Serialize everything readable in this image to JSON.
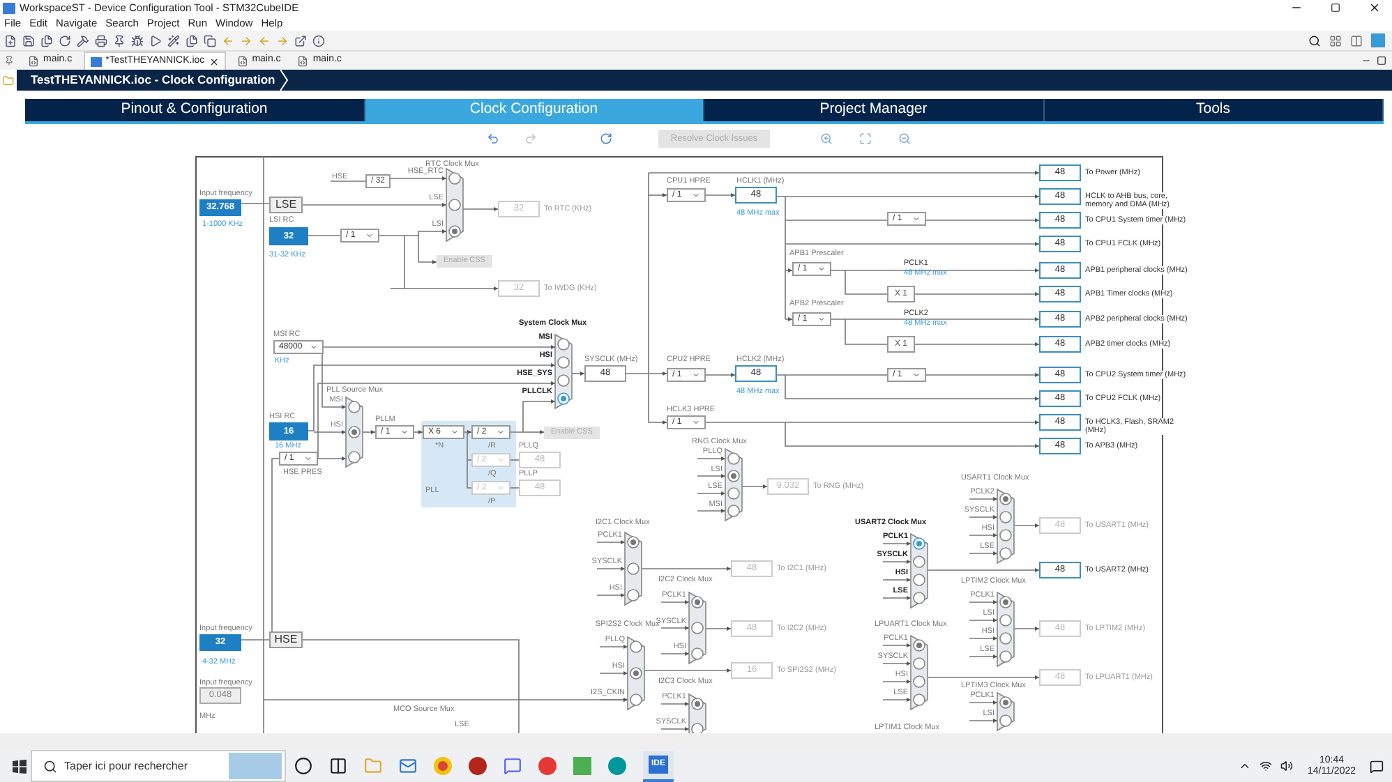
{
  "window": {
    "title": "WorkspaceST - Device Configuration Tool - STM32CubeIDE"
  },
  "menu": [
    "File",
    "Edit",
    "Navigate",
    "Search",
    "Project",
    "Run",
    "Window",
    "Help"
  ],
  "editor_tabs": [
    {
      "label": "main.c",
      "selected": false,
      "kind": "c"
    },
    {
      "label": "*TestTHEYANNICK.ioc",
      "selected": true,
      "kind": "ioc"
    },
    {
      "label": "main.c",
      "selected": false,
      "kind": "c"
    },
    {
      "label": "main.c",
      "selected": false,
      "kind": "c"
    }
  ],
  "breadcrumb": "TestTHEYANNICK.ioc - Clock Configuration",
  "tabs": [
    {
      "label": "Pinout & Configuration",
      "selected": false
    },
    {
      "label": "Clock Configuration",
      "selected": true
    },
    {
      "label": "Project Manager",
      "selected": false
    },
    {
      "label": "Tools",
      "selected": false
    }
  ],
  "resolve_button": {
    "label": "Resolve Clock Issues",
    "disabled": true
  },
  "diagram": {
    "labels": [
      {
        "text": "Input frequency",
        "kind": "caption"
      },
      {
        "text": "1-1000 KHz",
        "kind": "note"
      },
      {
        "text": "LSI RC",
        "kind": "caption"
      },
      {
        "text": "31-32 KHz",
        "kind": "note"
      },
      {
        "text": "HSE",
        "kind": "caption"
      },
      {
        "text": "MSI RC",
        "kind": "caption"
      },
      {
        "text": "KHz",
        "kind": "note"
      },
      {
        "text": "SYSCLK (MHz)",
        "kind": "caption"
      },
      {
        "text": "HSI RC",
        "kind": "caption"
      },
      {
        "text": "16 MHz",
        "kind": "note"
      },
      {
        "text": "HSE PRES",
        "kind": "caption"
      },
      {
        "text": "PLLM",
        "kind": "caption"
      },
      {
        "text": "*N",
        "kind": "caption"
      },
      {
        "text": "/R",
        "kind": "caption"
      },
      {
        "text": "/Q",
        "kind": "caption"
      },
      {
        "text": "PLL",
        "kind": "caption"
      },
      {
        "text": "/P",
        "kind": "caption"
      },
      {
        "text": "PLLQ",
        "kind": "caption"
      },
      {
        "text": "PLLP",
        "kind": "caption"
      },
      {
        "text": "CPU1 HPRE",
        "kind": "caption"
      },
      {
        "text": "HCLK1 (MHz)",
        "kind": "caption"
      },
      {
        "text": "48 MHz max",
        "kind": "note"
      },
      {
        "text": "CPU2 HPRE",
        "kind": "caption"
      },
      {
        "text": "HCLK2 (MHz)",
        "kind": "caption"
      },
      {
        "text": "48 MHz max",
        "kind": "note"
      },
      {
        "text": "HCLK3 HPRE",
        "kind": "caption"
      },
      {
        "text": "APB1 Prescaler",
        "kind": "caption"
      },
      {
        "text": "PCLK1",
        "kind": "dark"
      },
      {
        "text": "48 MHz max",
        "kind": "note"
      },
      {
        "text": "APB2 Prescaler",
        "kind": "caption"
      },
      {
        "text": "PCLK2",
        "kind": "dark"
      },
      {
        "text": "48 MHz max",
        "kind": "note"
      },
      {
        "text": "Input frequency",
        "kind": "caption"
      },
      {
        "text": "4-32 MHz",
        "kind": "note"
      },
      {
        "text": "Input frequency",
        "kind": "caption"
      },
      {
        "text": "MHz",
        "kind": "caption"
      },
      {
        "text": "MCO Source Mux",
        "kind": "caption"
      },
      {
        "text": "LSE",
        "kind": "caption"
      },
      {
        "text": "LPTIM1 Clock Mux",
        "kind": "caption"
      }
    ],
    "blocks": [
      {
        "text": "LSE",
        "kind": "source"
      },
      {
        "text": "HSE",
        "kind": "source"
      },
      {
        "text": "/ 32",
        "kind": "divider"
      },
      {
        "text": "X 1",
        "kind": "divider"
      },
      {
        "text": "X 1",
        "kind": "divider"
      }
    ],
    "buttons": [
      {
        "label": "Enable CSS",
        "disabled": true
      },
      {
        "label": "Enable CSS",
        "disabled": true
      }
    ],
    "dropdowns": [
      {
        "value": "/ 1",
        "disabled": false
      },
      {
        "value": "48000",
        "disabled": false
      },
      {
        "value": "/ 1",
        "disabled": false
      },
      {
        "value": "/ 1",
        "disabled": false
      },
      {
        "value": "X 6",
        "disabled": false
      },
      {
        "value": "/ 2",
        "disabled": false
      },
      {
        "value": "/ 2",
        "disabled": true
      },
      {
        "value": "/ 2",
        "disabled": true
      },
      {
        "value": "/ 1",
        "disabled": false
      },
      {
        "value": "/ 1",
        "disabled": false
      },
      {
        "value": "/ 1",
        "disabled": false
      },
      {
        "value": "/ 1",
        "disabled": false
      },
      {
        "value": "/ 1",
        "disabled": false
      },
      {
        "value": "/ 1",
        "disabled": false
      },
      {
        "value": "/ 1",
        "disabled": false
      }
    ],
    "boxes": [
      {
        "value": "32.768",
        "kind": "input"
      },
      {
        "value": "32",
        "kind": "input"
      },
      {
        "value": "16",
        "kind": "input"
      },
      {
        "value": "32",
        "kind": "input"
      },
      {
        "value": "0.048",
        "kind": "fixed"
      },
      {
        "value": "32",
        "kind": "disabled",
        "target": "To RTC (KHz)"
      },
      {
        "value": "32",
        "kind": "disabled",
        "target": "To IWDG (KHz)"
      },
      {
        "value": "48",
        "kind": "plain"
      },
      {
        "value": "48",
        "kind": "disabled"
      },
      {
        "value": "48",
        "kind": "disabled"
      },
      {
        "value": "48",
        "kind": "active"
      },
      {
        "value": "48",
        "kind": "active"
      },
      {
        "value": "9.032",
        "kind": "disabled",
        "target": "To RNG (MHz)"
      },
      {
        "value": "48",
        "kind": "disabled",
        "target": "To I2C1 (MHz)"
      },
      {
        "value": "48",
        "kind": "disabled",
        "target": "To I2C2 (MHz)"
      },
      {
        "value": "16",
        "kind": "disabled",
        "target": "To SPI2S2 (MHz)"
      },
      {
        "value": "48",
        "kind": "active",
        "target": "To Power (MHz)"
      },
      {
        "value": "48",
        "kind": "active",
        "target": "HCLK to AHB bus, core, memory and DMA (MHz)"
      },
      {
        "value": "48",
        "kind": "active",
        "target": "To CPU1 System timer (MHz)"
      },
      {
        "value": "48",
        "kind": "active",
        "target": "To CPU1 FCLK (MHz)"
      },
      {
        "value": "48",
        "kind": "active",
        "target": "APB1 peripheral clocks (MHz)"
      },
      {
        "value": "48",
        "kind": "active",
        "target": "APB1 Timer clocks (MHz)"
      },
      {
        "value": "48",
        "kind": "active",
        "target": "APB2 peripheral clocks (MHz)"
      },
      {
        "value": "48",
        "kind": "active",
        "target": "APB2 timer clocks (MHz)"
      },
      {
        "value": "48",
        "kind": "active",
        "target": "To CPU2 System timer (MHz)"
      },
      {
        "value": "48",
        "kind": "active",
        "target": "To CPU2 FCLK (MHz)"
      },
      {
        "value": "48",
        "kind": "active",
        "target": "To HCLK3, Flash, SRAM2 (MHz)"
      },
      {
        "value": "48",
        "kind": "active",
        "target": "To APB3 (MHz)"
      },
      {
        "value": "48",
        "kind": "disabled",
        "target": "To USART1 (MHz)"
      },
      {
        "value": "48",
        "kind": "active",
        "target": "To USART2 (MHz)"
      },
      {
        "value": "48",
        "kind": "disabled",
        "target": "To LPTIM2 (MHz)"
      },
      {
        "value": "48",
        "kind": "disabled",
        "target": "To LPUART1 (MHz)"
      }
    ],
    "muxes": [
      {
        "title": "RTC Clock Mux",
        "highlighted": false,
        "inputs": [
          {
            "label": "HSE_RTC",
            "selected": false
          },
          {
            "label": "LSE",
            "selected": false
          },
          {
            "label": "LSI",
            "selected": true
          }
        ]
      },
      {
        "title": "System Clock Mux",
        "highlighted": true,
        "inputs": [
          {
            "label": "MSI",
            "selected": false
          },
          {
            "label": "HSI",
            "selected": false
          },
          {
            "label": "HSE_SYS",
            "selected": false
          },
          {
            "label": "PLLCLK",
            "selected": true
          }
        ]
      },
      {
        "title": "PLL Source Mux",
        "highlighted": false,
        "inputs": [
          {
            "label": "MSI",
            "selected": false
          },
          {
            "label": "HSI",
            "selected": true
          },
          {
            "selected": false
          }
        ]
      },
      {
        "title": "RNG Clock Mux",
        "highlighted": false,
        "inputs": [
          {
            "label": "PLLQ",
            "selected": false
          },
          {
            "label": "LSI",
            "selected": true
          },
          {
            "label": "LSE",
            "selected": false
          },
          {
            "label": "MSI",
            "selected": false
          }
        ]
      },
      {
        "title": "I2C1 Clock Mux",
        "highlighted": false,
        "inputs": [
          {
            "label": "PCLK1",
            "selected": true
          },
          {
            "label": "SYSCLK",
            "selected": false
          },
          {
            "label": "HSI",
            "selected": false
          }
        ]
      },
      {
        "title": "I2C2 Clock Mux",
        "highlighted": false,
        "inputs": [
          {
            "label": "PCLK1",
            "selected": true
          },
          {
            "label": "SYSCLK",
            "selected": false
          },
          {
            "label": "HSI",
            "selected": false
          }
        ]
      },
      {
        "title": "SPI2S2 Clock Mux",
        "highlighted": false,
        "inputs": [
          {
            "label": "PLLQ",
            "selected": false
          },
          {
            "label": "HSI",
            "selected": true
          },
          {
            "label": "I2S_CKIN",
            "selected": false
          }
        ]
      },
      {
        "title": "I2C3 Clock Mux",
        "highlighted": false,
        "inputs": [
          {
            "label": "PCLK1",
            "selected": true
          },
          {
            "label": "SYSCLK",
            "selected": false
          }
        ]
      },
      {
        "title": "USART2 Clock Mux",
        "highlighted": true,
        "inputs": [
          {
            "label": "PCLK1",
            "selected": true
          },
          {
            "label": "SYSCLK",
            "selected": false
          },
          {
            "label": "HSI",
            "selected": false
          },
          {
            "label": "LSE",
            "selected": false
          }
        ]
      },
      {
        "title": "USART1 Clock Mux",
        "highlighted": false,
        "inputs": [
          {
            "label": "PCLK2",
            "selected": true
          },
          {
            "label": "SYSCLK",
            "selected": false
          },
          {
            "label": "HSI",
            "selected": false
          },
          {
            "label": "LSE",
            "selected": false
          }
        ]
      },
      {
        "title": "LPTIM2 Clock Mux",
        "highlighted": false,
        "inputs": [
          {
            "label": "PCLK1",
            "selected": true
          },
          {
            "label": "LSI",
            "selected": false
          },
          {
            "label": "HSI",
            "selected": false
          },
          {
            "label": "LSE",
            "selected": false
          }
        ]
      },
      {
        "title": "LPUART1 Clock Mux",
        "highlighted": false,
        "inputs": [
          {
            "label": "PCLK1",
            "selected": true
          },
          {
            "label": "SYSCLK",
            "selected": false
          },
          {
            "label": "HSI",
            "selected": false
          },
          {
            "label": "LSE",
            "selected": false
          }
        ]
      },
      {
        "title": "LPTIM3 Clock Mux",
        "highlighted": false,
        "inputs": [
          {
            "label": "PCLK1",
            "selected": true
          },
          {
            "label": "LSI",
            "selected": false
          }
        ]
      }
    ]
  },
  "taskbar": {
    "search_placeholder": "Taper ici pour rechercher",
    "apps": [
      {
        "label": "IDE",
        "selected": true
      }
    ],
    "time": "10:44",
    "date": "14/11/2022"
  }
}
